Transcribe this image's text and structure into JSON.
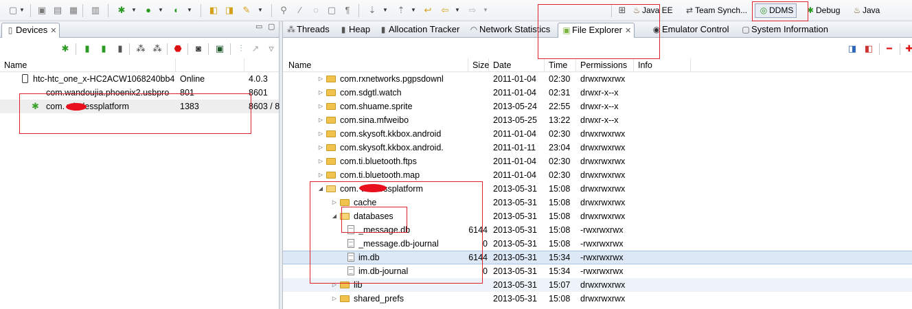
{
  "perspectives": [
    {
      "label": "Java EE",
      "icon": "java-ee-icon"
    },
    {
      "label": "Team Synch...",
      "icon": "team-synch-icon"
    },
    {
      "label": "DDMS",
      "icon": "ddms-icon",
      "active": true
    },
    {
      "label": "Debug",
      "icon": "debug-icon"
    },
    {
      "label": "Java",
      "icon": "java-icon"
    }
  ],
  "devices_view": {
    "tab_label": "Devices",
    "columns": [
      "Name",
      "",
      ""
    ],
    "rows": [
      {
        "name": "htc-htc_one_x-HC2ACW1068240bb4",
        "status": "Online",
        "port": "4.0.3",
        "icon": "phone-icon"
      },
      {
        "name": "com.wandoujia.phoenix2.usbpro",
        "status": "801",
        "port": "8601",
        "icon": ""
      },
      {
        "name": "com.    wirelessplatform",
        "status": "1383",
        "port": "8603 / 8",
        "icon": "bug-icon",
        "selected": true
      }
    ]
  },
  "right_tabs": [
    {
      "label": "Threads",
      "icon": "threads-icon"
    },
    {
      "label": "Heap",
      "icon": "heap-icon"
    },
    {
      "label": "Allocation Tracker",
      "icon": "allocation-tracker-icon"
    },
    {
      "label": "Network Statistics",
      "icon": "network-icon"
    },
    {
      "label": "File Explorer",
      "icon": "android-icon",
      "active": true
    },
    {
      "label": "Emulator Control",
      "icon": "emulator-icon"
    },
    {
      "label": "System Information",
      "icon": "system-info-icon"
    }
  ],
  "file_explorer": {
    "columns": [
      "Name",
      "Size",
      "Date",
      "Time",
      "Permissions",
      "Info"
    ],
    "rows": [
      {
        "name": "com.rxnetworks.pgpsdownl",
        "size": "",
        "date": "2011-01-04",
        "time": "02:30",
        "perm": "drwxrwxrwx",
        "type": "folder",
        "level": 0,
        "expanded": false
      },
      {
        "name": "com.sdgtl.watch",
        "size": "",
        "date": "2011-01-04",
        "time": "02:31",
        "perm": "drwxr-x--x",
        "type": "folder",
        "level": 0,
        "expanded": false
      },
      {
        "name": "com.shuame.sprite",
        "size": "",
        "date": "2013-05-24",
        "time": "22:55",
        "perm": "drwxr-x--x",
        "type": "folder",
        "level": 0,
        "expanded": false
      },
      {
        "name": "com.sina.mfweibo",
        "size": "",
        "date": "2013-05-25",
        "time": "13:22",
        "perm": "drwxr-x--x",
        "type": "folder",
        "level": 0,
        "expanded": false
      },
      {
        "name": "com.skysoft.kkbox.android",
        "size": "",
        "date": "2011-01-04",
        "time": "02:30",
        "perm": "drwxrwxrwx",
        "type": "folder",
        "level": 0,
        "expanded": false
      },
      {
        "name": "com.skysoft.kkbox.android.",
        "size": "",
        "date": "2011-01-11",
        "time": "23:04",
        "perm": "drwxrwxrwx",
        "type": "folder",
        "level": 0,
        "expanded": false
      },
      {
        "name": "com.ti.bluetooth.ftps",
        "size": "",
        "date": "2011-01-04",
        "time": "02:30",
        "perm": "drwxrwxrwx",
        "type": "folder",
        "level": 0,
        "expanded": false
      },
      {
        "name": "com.ti.bluetooth.map",
        "size": "",
        "date": "2011-01-04",
        "time": "02:30",
        "perm": "drwxrwxrwx",
        "type": "folder",
        "level": 0,
        "expanded": false
      },
      {
        "name": "com.      wirelessplatform",
        "size": "",
        "date": "2013-05-31",
        "time": "15:08",
        "perm": "drwxrwxrwx",
        "type": "folder",
        "level": 0,
        "expanded": true
      },
      {
        "name": "cache",
        "size": "",
        "date": "2013-05-31",
        "time": "15:08",
        "perm": "drwxrwxrwx",
        "type": "folder",
        "level": 1,
        "expanded": false
      },
      {
        "name": "databases",
        "size": "",
        "date": "2013-05-31",
        "time": "15:08",
        "perm": "drwxrwxrwx",
        "type": "folder",
        "level": 1,
        "expanded": true
      },
      {
        "name": "_message.db",
        "size": "6144",
        "date": "2013-05-31",
        "time": "15:08",
        "perm": "-rwxrwxrwx",
        "type": "file",
        "level": 2
      },
      {
        "name": "_message.db-journal",
        "size": "0",
        "date": "2013-05-31",
        "time": "15:08",
        "perm": "-rwxrwxrwx",
        "type": "file",
        "level": 2
      },
      {
        "name": "im.db",
        "size": "6144",
        "date": "2013-05-31",
        "time": "15:34",
        "perm": "-rwxrwxrwx",
        "type": "file",
        "level": 2,
        "selected": true
      },
      {
        "name": "im.db-journal",
        "size": "0",
        "date": "2013-05-31",
        "time": "15:34",
        "perm": "-rwxrwxrwx",
        "type": "file",
        "level": 2
      },
      {
        "name": "lib",
        "size": "",
        "date": "2013-05-31",
        "time": "15:07",
        "perm": "drwxrwxrwx",
        "type": "folder",
        "level": 1,
        "expanded": false,
        "hover": true
      },
      {
        "name": "shared_prefs",
        "size": "",
        "date": "2013-05-31",
        "time": "15:08",
        "perm": "drwxrwxrwx",
        "type": "folder",
        "level": 1,
        "expanded": false
      }
    ]
  },
  "colors": {
    "annotation": "#e0202a",
    "selection": "#dde8f6",
    "accent_green": "#2b9a22"
  }
}
